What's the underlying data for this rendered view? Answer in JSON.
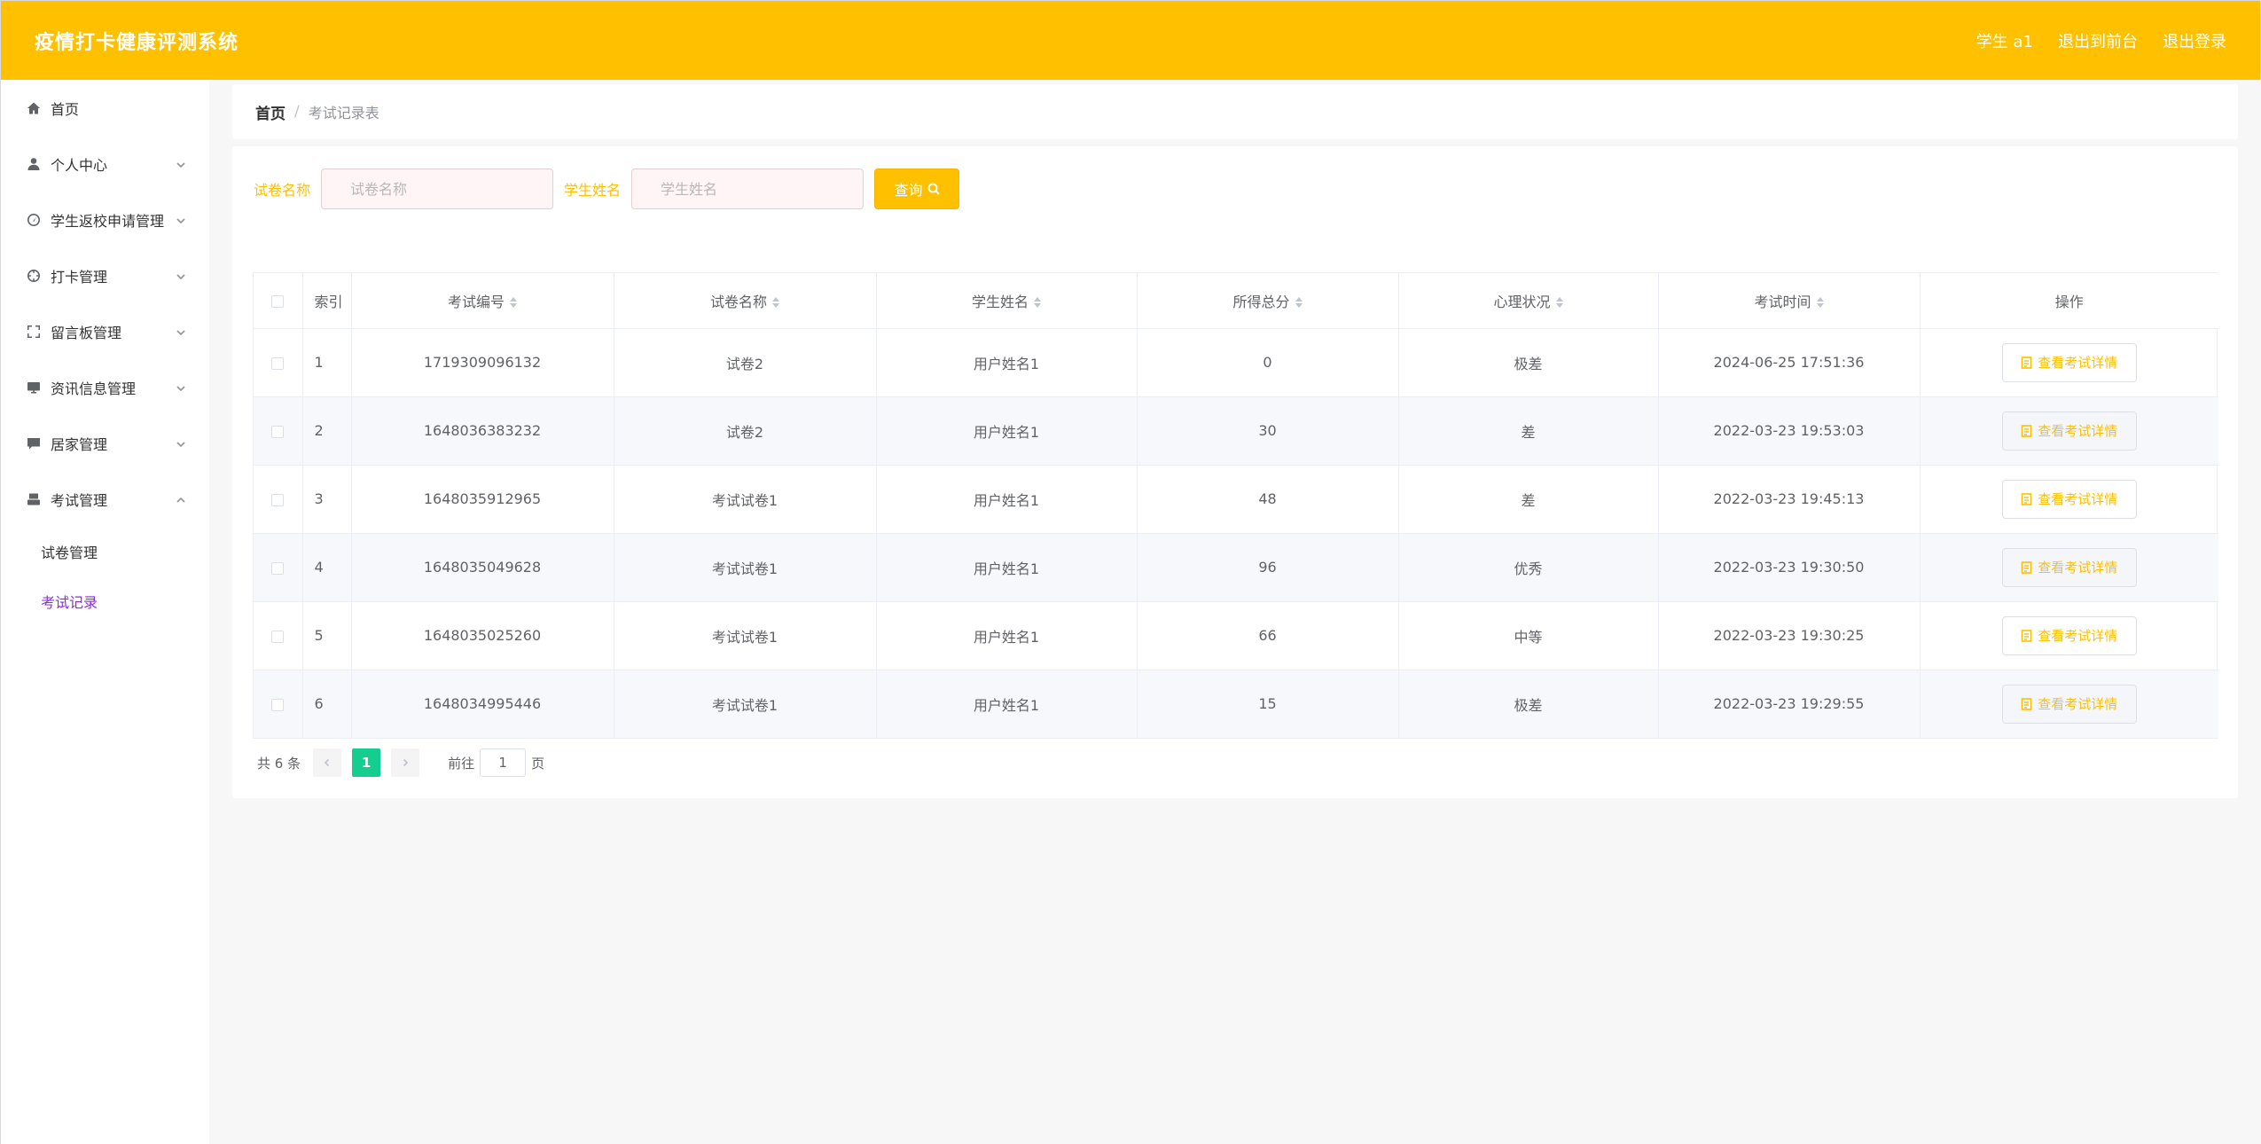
{
  "header": {
    "title": "疫情打卡健康评测系统",
    "user_label": "学生 a1",
    "back_label": "退出到前台",
    "logout_label": "退出登录"
  },
  "sidebar": {
    "items": [
      {
        "label": "首页",
        "icon": "home-icon"
      },
      {
        "label": "个人中心",
        "icon": "user-icon"
      },
      {
        "label": "学生返校申请管理",
        "icon": "gauge-icon"
      },
      {
        "label": "打卡管理",
        "icon": "crosshair-icon"
      },
      {
        "label": "留言板管理",
        "icon": "fullscreen-icon"
      },
      {
        "label": "资讯信息管理",
        "icon": "monitor-icon"
      },
      {
        "label": "居家管理",
        "icon": "chat-icon"
      },
      {
        "label": "考试管理",
        "icon": "printer-icon"
      }
    ],
    "sub_items": [
      {
        "label": "试卷管理",
        "active": false
      },
      {
        "label": "考试记录",
        "active": true
      }
    ],
    "active_color": "#8a2be2"
  },
  "breadcrumb": {
    "home": "首页",
    "separator": "/",
    "current": "考试记录表"
  },
  "search": {
    "paper_label": "试卷名称",
    "paper_placeholder": "试卷名称",
    "student_label": "学生姓名",
    "student_placeholder": "学生姓名",
    "query_label": "查询"
  },
  "table": {
    "columns": [
      "索引",
      "考试编号",
      "试卷名称",
      "学生姓名",
      "所得总分",
      "心理状况",
      "考试时间",
      "操作"
    ],
    "rows": [
      {
        "index": "1",
        "exam_no": "1719309096132",
        "paper": "试卷2",
        "student": "用户姓名1",
        "score": "0",
        "mental": "极差",
        "time": "2024-06-25 17:51:36",
        "action": "查看考试详情"
      },
      {
        "index": "2",
        "exam_no": "1648036383232",
        "paper": "试卷2",
        "student": "用户姓名1",
        "score": "30",
        "mental": "差",
        "time": "2022-03-23 19:53:03",
        "action": "查看考试详情"
      },
      {
        "index": "3",
        "exam_no": "1648035912965",
        "paper": "考试试卷1",
        "student": "用户姓名1",
        "score": "48",
        "mental": "差",
        "time": "2022-03-23 19:45:13",
        "action": "查看考试详情"
      },
      {
        "index": "4",
        "exam_no": "1648035049628",
        "paper": "考试试卷1",
        "student": "用户姓名1",
        "score": "96",
        "mental": "优秀",
        "time": "2022-03-23 19:30:50",
        "action": "查看考试详情"
      },
      {
        "index": "5",
        "exam_no": "1648035025260",
        "paper": "考试试卷1",
        "student": "用户姓名1",
        "score": "66",
        "mental": "中等",
        "time": "2022-03-23 19:30:25",
        "action": "查看考试详情"
      },
      {
        "index": "6",
        "exam_no": "1648034995446",
        "paper": "考试试卷1",
        "student": "用户姓名1",
        "score": "15",
        "mental": "极差",
        "time": "2022-03-23 19:29:55",
        "action": "查看考试详情"
      }
    ]
  },
  "pagination": {
    "total_text": "共 6 条",
    "current_page": "1",
    "goto_prefix": "前往",
    "goto_value": "1",
    "goto_suffix": "页"
  },
  "colors": {
    "primary": "#ffc000",
    "pager_active": "#13ce8f"
  }
}
